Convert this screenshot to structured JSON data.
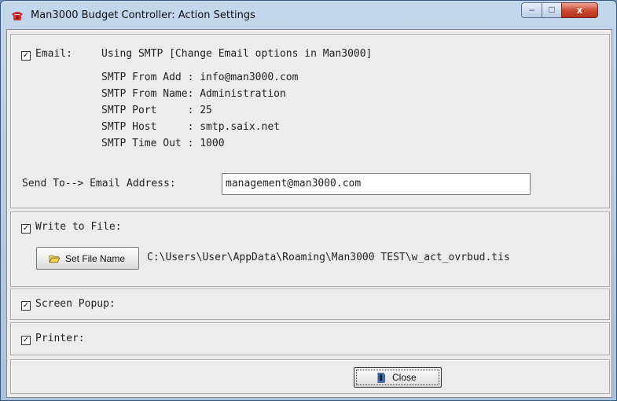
{
  "window": {
    "title": "Man3000 Budget Controller: Action Settings",
    "controls": {
      "minimize": "–",
      "maximize": "□",
      "close": "x"
    }
  },
  "email": {
    "checked": true,
    "label": "Email:",
    "mode_text": "Using SMTP [Change Email options in Man3000]",
    "smtp_lines": [
      "SMTP From Add : info@man3000.com",
      "SMTP From Name: Administration",
      "SMTP Port     : 25",
      "SMTP Host     : smtp.saix.net",
      "SMTP Time Out : 1000"
    ],
    "send_to_label": "Send To--> Email Address:",
    "send_to_value": "management@man3000.com"
  },
  "file": {
    "checked": true,
    "label": "Write to File:",
    "button_label": "Set File Name",
    "button_icon": "folder-open-icon",
    "path": "C:\\Users\\User\\AppData\\Roaming\\Man3000 TEST\\w_act_ovrbud.tis"
  },
  "popup": {
    "checked": true,
    "label": "Screen Popup:"
  },
  "printer": {
    "checked": true,
    "label": "Printer:"
  },
  "footer": {
    "close_label": "Close",
    "close_icon": "door-exit-icon"
  },
  "colors": {
    "title_bar": "#b9cfe8",
    "close_button": "#c8452e",
    "panel_bg": "#ececec"
  }
}
